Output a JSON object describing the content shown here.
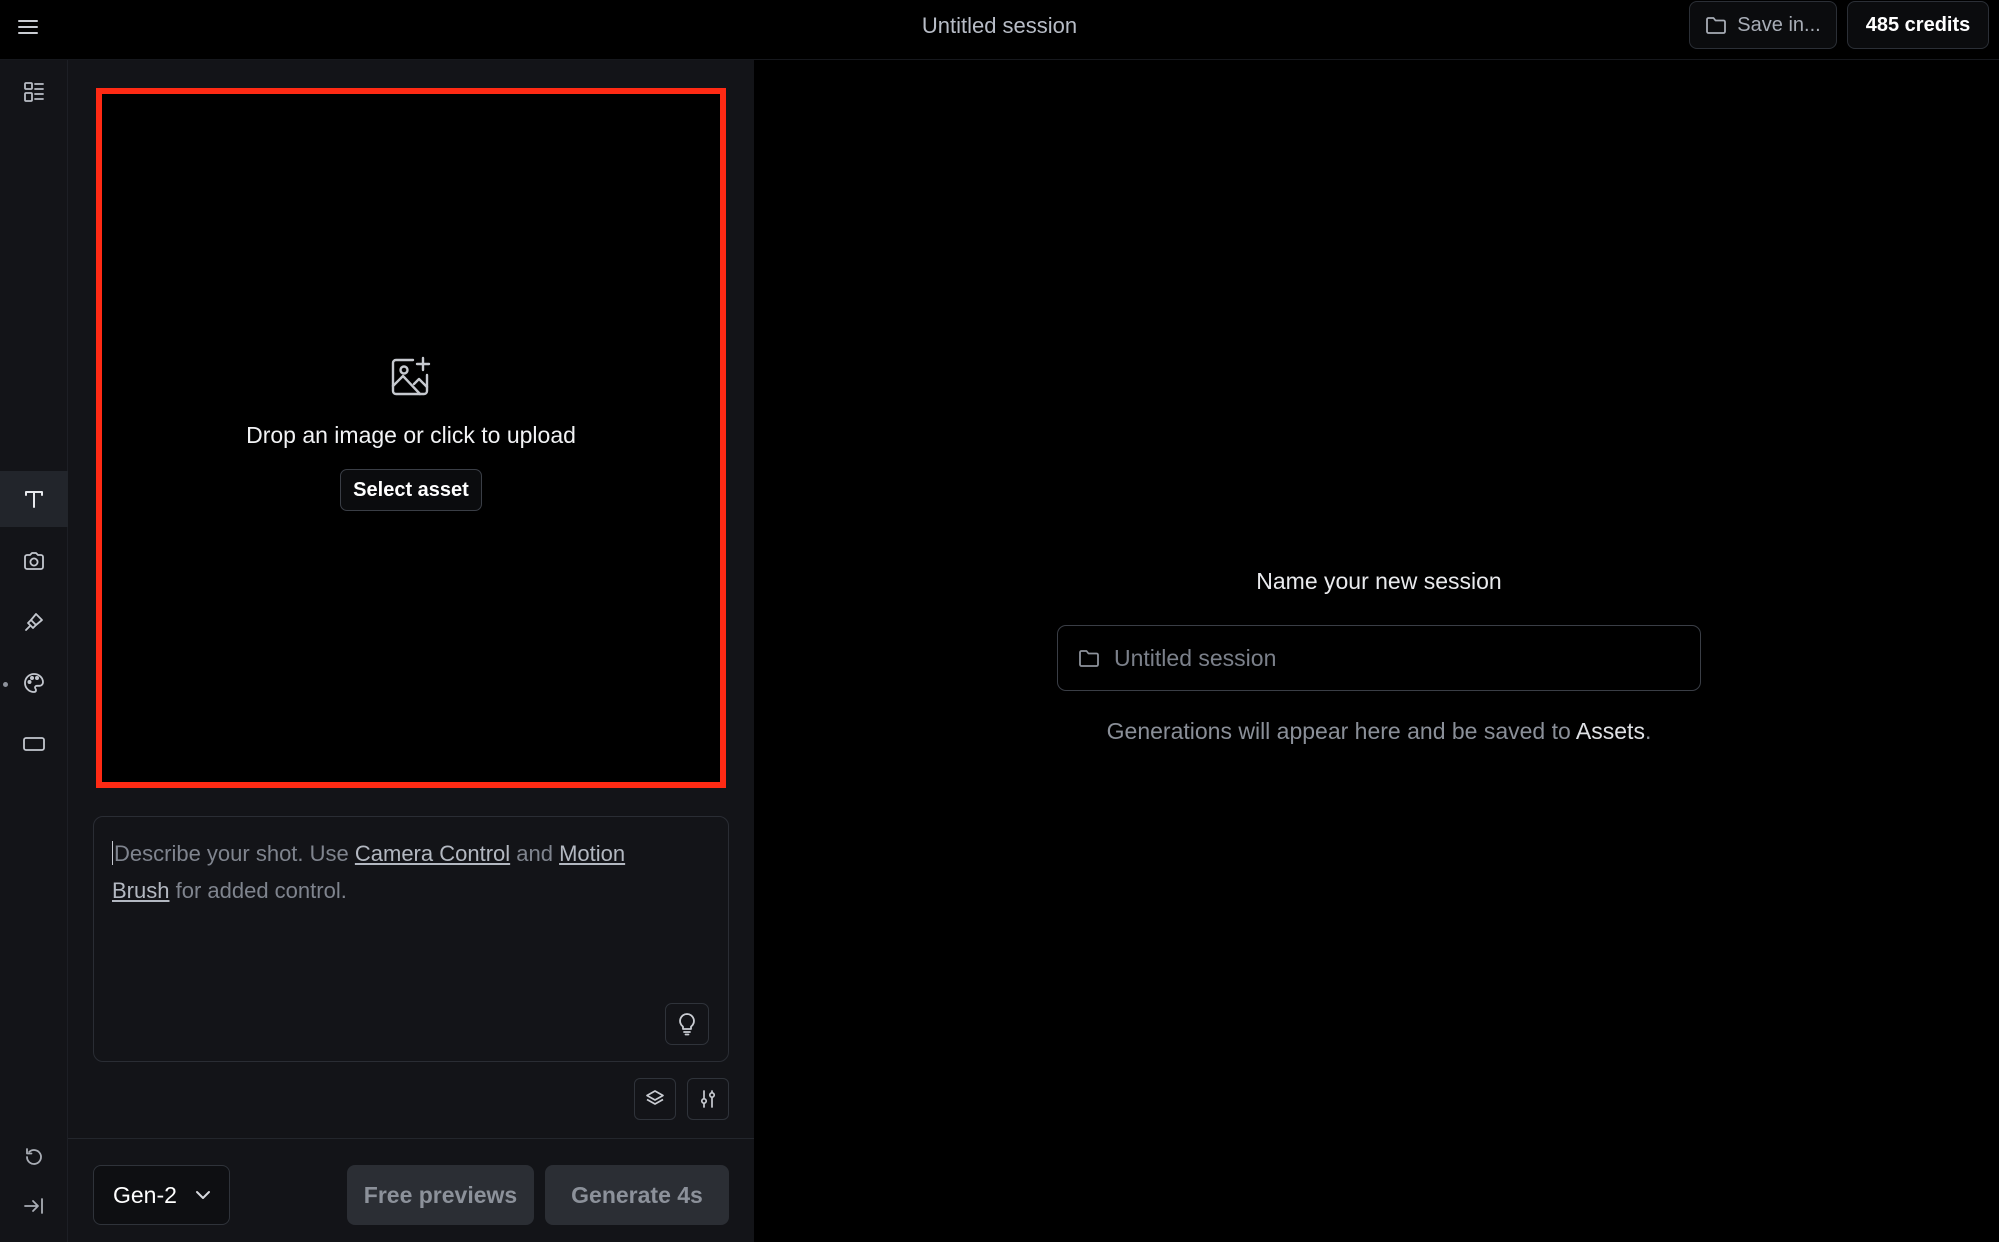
{
  "header": {
    "title": "Untitled session",
    "save_label": "Save in...",
    "credits_label": "485 credits"
  },
  "rail": {
    "tools": [
      {
        "name": "assets",
        "icon": "dashboard-icon"
      },
      {
        "name": "text",
        "icon": "text-icon",
        "active": true
      },
      {
        "name": "camera-control",
        "icon": "camera-icon"
      },
      {
        "name": "motion-brush",
        "icon": "brush-icon"
      },
      {
        "name": "style",
        "icon": "palette-icon"
      },
      {
        "name": "aspect-ratio",
        "icon": "rectangle-icon"
      }
    ],
    "bottom": [
      {
        "name": "history",
        "icon": "undo-icon"
      },
      {
        "name": "collapse",
        "icon": "arrow-right-bar-icon"
      }
    ]
  },
  "upload": {
    "drop_text": "Drop an image or click to upload",
    "select_label": "Select asset",
    "highlight_color": "#ff2a14"
  },
  "prompt": {
    "placeholder_prefix": "Describe your shot. Use ",
    "link_camera": "Camera Control",
    "middle": " and ",
    "link_brush": "Motion Brush",
    "suffix": " for added control."
  },
  "footer": {
    "model": "Gen-2",
    "free_previews": "Free previews",
    "generate": "Generate 4s"
  },
  "main": {
    "heading": "Name your new session",
    "input_placeholder": "Untitled session",
    "note_prefix": "Generations will appear here and be saved to ",
    "note_link": "Assets",
    "note_suffix": "."
  }
}
